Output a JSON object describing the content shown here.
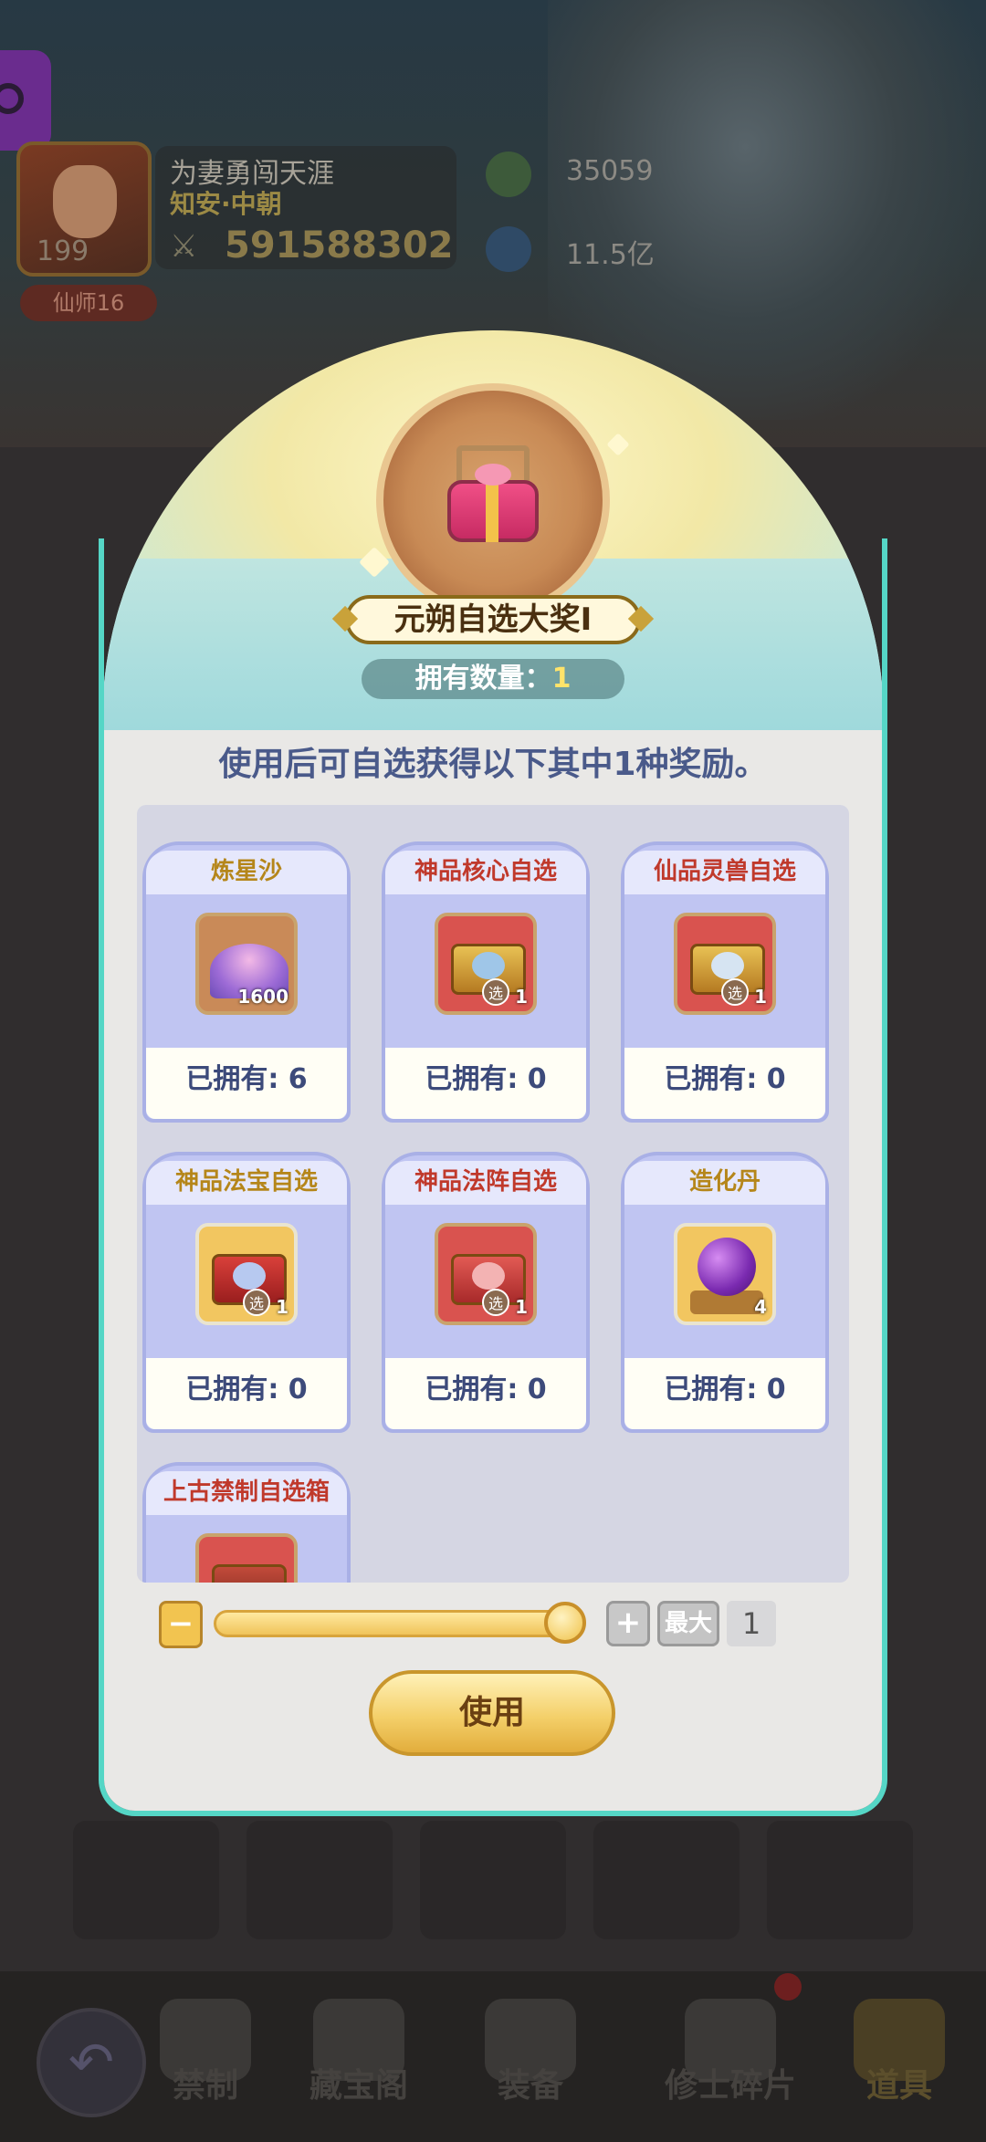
{
  "player": {
    "name": "为妻勇闯天涯",
    "server": "知安·中朝",
    "level": "199",
    "rank": "仙师16",
    "power": "591588302"
  },
  "resources": [
    {
      "icon": "green-leaf-icon",
      "value": "35059"
    },
    {
      "icon": "blue-orb-icon",
      "value": "11.5亿"
    }
  ],
  "dialog": {
    "title": "元朔自选大奖Ⅰ",
    "owned_label": "拥有数量：",
    "owned_count": "1",
    "description": "使用后可自选获得以下其中1种奖励。",
    "owned_prefix": "已拥有: ",
    "items": [
      {
        "name": "炼星沙",
        "title_color": "gold",
        "icon": "star-sand-icon",
        "qty": "1600",
        "selectable": false,
        "owned": "已拥有: 6"
      },
      {
        "name": "神品核心自选",
        "title_color": "red",
        "icon": "core-chest-icon",
        "qty": "1",
        "selectable": true,
        "owned": "已拥有: 0"
      },
      {
        "name": "仙品灵兽自选",
        "title_color": "red",
        "icon": "beast-chest-icon",
        "qty": "1",
        "selectable": true,
        "owned": "已拥有: 0"
      },
      {
        "name": "神品法宝自选",
        "title_color": "gold",
        "icon": "treasure-chest-icon",
        "qty": "1",
        "selectable": true,
        "owned": "已拥有: 0"
      },
      {
        "name": "神品法阵自选",
        "title_color": "red",
        "icon": "array-chest-icon",
        "qty": "1",
        "selectable": true,
        "owned": "已拥有: 0"
      },
      {
        "name": "造化丹",
        "title_color": "gold",
        "icon": "purple-pill-icon",
        "qty": "4",
        "selectable": false,
        "owned": "已拥有: 0"
      },
      {
        "name": "上古禁制自选箱",
        "title_color": "red",
        "icon": "ancient-chest-icon",
        "qty": "",
        "selectable": true,
        "owned": ""
      }
    ],
    "select_mark": "选",
    "minus_label": "−",
    "plus_label": "+",
    "max_label": "最大",
    "quantity": "1",
    "slider_fraction": 1.0,
    "use_label": "使用"
  },
  "bottom_nav": [
    {
      "label": "禁制",
      "icon": "seal-icon",
      "active": false
    },
    {
      "label": "藏宝阁",
      "icon": "pavilion-icon",
      "active": false
    },
    {
      "label": "装备",
      "icon": "armor-icon",
      "active": false
    },
    {
      "label": "修士碎片",
      "icon": "fragment-icon",
      "active": false,
      "badge": true
    },
    {
      "label": "道具",
      "icon": "gold-pot-icon",
      "active": true
    }
  ]
}
